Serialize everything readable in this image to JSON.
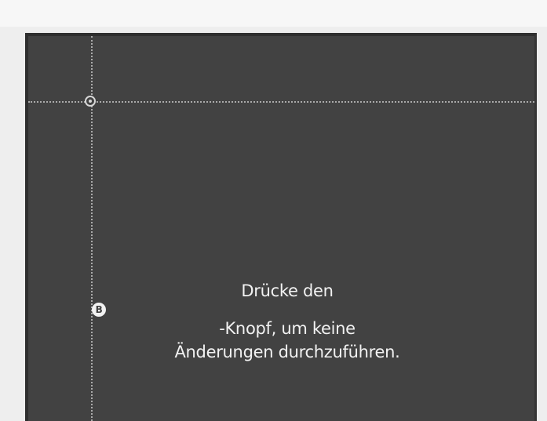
{
  "screen": {
    "message_part1": "Drücke den ",
    "button_glyph": "B",
    "message_part2": "-Knopf, um keine",
    "message_line2": "Änderungen durchzuführen."
  },
  "colors": {
    "screen_bg": "#424242",
    "guide_line": "#bdbdbd",
    "text": "#f2f2f2"
  },
  "icons": {
    "crosshair": "crosshair-cursor-icon",
    "b_button": "b-button-icon"
  }
}
